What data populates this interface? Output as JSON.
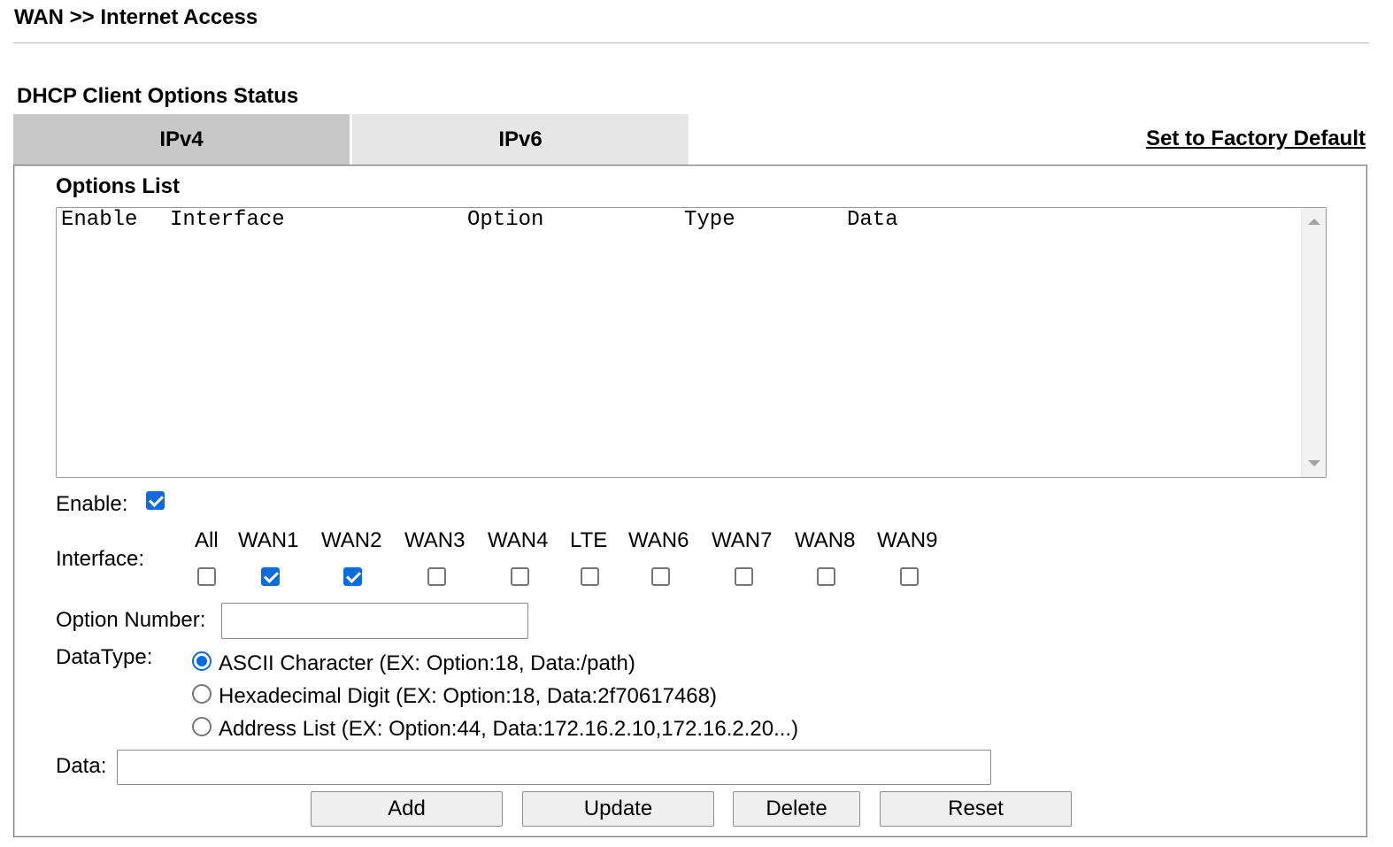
{
  "breadcrumb": "WAN >> Internet Access",
  "section_title": "DHCP Client Options Status",
  "tabs": [
    {
      "label": "IPv4",
      "active": true
    },
    {
      "label": "IPv6",
      "active": false
    }
  ],
  "factory_default_link": "Set to Factory Default",
  "options_list": {
    "title": "Options List",
    "columns": [
      "Enable",
      "Interface",
      "Option",
      "Type",
      "Data"
    ],
    "rows": []
  },
  "form": {
    "enable_label": "Enable:",
    "enable_checked": true,
    "interface_label": "Interface:",
    "interfaces": [
      {
        "name": "All",
        "checked": false
      },
      {
        "name": "WAN1",
        "checked": true
      },
      {
        "name": "WAN2",
        "checked": true
      },
      {
        "name": "WAN3",
        "checked": false
      },
      {
        "name": "WAN4",
        "checked": false
      },
      {
        "name": "LTE",
        "checked": false
      },
      {
        "name": "WAN6",
        "checked": false
      },
      {
        "name": "WAN7",
        "checked": false
      },
      {
        "name": "WAN8",
        "checked": false
      },
      {
        "name": "WAN9",
        "checked": false
      }
    ],
    "option_number_label": "Option Number:",
    "option_number_value": "",
    "datatype_label": "DataType:",
    "datatypes": [
      {
        "label": "ASCII Character (EX: Option:18, Data:/path)",
        "selected": true
      },
      {
        "label": "Hexadecimal Digit (EX: Option:18, Data:2f70617468)",
        "selected": false
      },
      {
        "label": "Address List (EX: Option:44, Data:172.16.2.10,172.16.2.20...)",
        "selected": false
      }
    ],
    "data_label": "Data:",
    "data_value": ""
  },
  "buttons": {
    "add": "Add",
    "update": "Update",
    "delete": "Delete",
    "reset": "Reset"
  },
  "colors": {
    "accent": "#0b6be0",
    "tab_active": "#c8c8c8",
    "tab_inactive": "#e6e6e6"
  }
}
